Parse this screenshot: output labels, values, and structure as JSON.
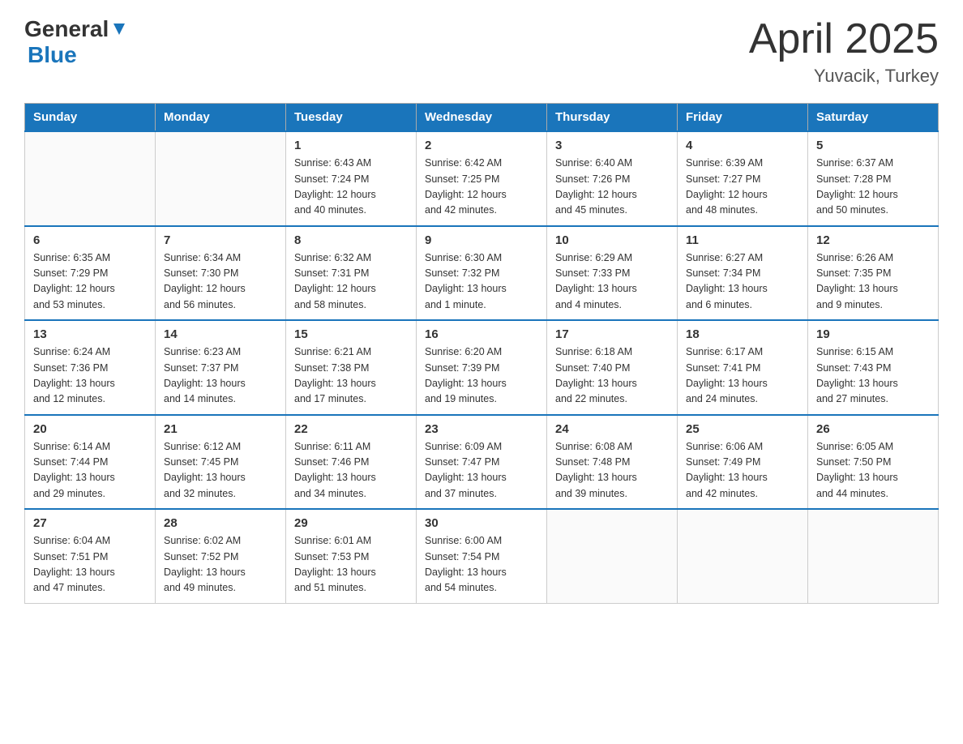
{
  "header": {
    "logo_general": "General",
    "logo_blue": "Blue",
    "month_title": "April 2025",
    "location": "Yuvacik, Turkey"
  },
  "days_of_week": [
    "Sunday",
    "Monday",
    "Tuesday",
    "Wednesday",
    "Thursday",
    "Friday",
    "Saturday"
  ],
  "weeks": [
    [
      {
        "day": "",
        "info": ""
      },
      {
        "day": "",
        "info": ""
      },
      {
        "day": "1",
        "info": "Sunrise: 6:43 AM\nSunset: 7:24 PM\nDaylight: 12 hours\nand 40 minutes."
      },
      {
        "day": "2",
        "info": "Sunrise: 6:42 AM\nSunset: 7:25 PM\nDaylight: 12 hours\nand 42 minutes."
      },
      {
        "day": "3",
        "info": "Sunrise: 6:40 AM\nSunset: 7:26 PM\nDaylight: 12 hours\nand 45 minutes."
      },
      {
        "day": "4",
        "info": "Sunrise: 6:39 AM\nSunset: 7:27 PM\nDaylight: 12 hours\nand 48 minutes."
      },
      {
        "day": "5",
        "info": "Sunrise: 6:37 AM\nSunset: 7:28 PM\nDaylight: 12 hours\nand 50 minutes."
      }
    ],
    [
      {
        "day": "6",
        "info": "Sunrise: 6:35 AM\nSunset: 7:29 PM\nDaylight: 12 hours\nand 53 minutes."
      },
      {
        "day": "7",
        "info": "Sunrise: 6:34 AM\nSunset: 7:30 PM\nDaylight: 12 hours\nand 56 minutes."
      },
      {
        "day": "8",
        "info": "Sunrise: 6:32 AM\nSunset: 7:31 PM\nDaylight: 12 hours\nand 58 minutes."
      },
      {
        "day": "9",
        "info": "Sunrise: 6:30 AM\nSunset: 7:32 PM\nDaylight: 13 hours\nand 1 minute."
      },
      {
        "day": "10",
        "info": "Sunrise: 6:29 AM\nSunset: 7:33 PM\nDaylight: 13 hours\nand 4 minutes."
      },
      {
        "day": "11",
        "info": "Sunrise: 6:27 AM\nSunset: 7:34 PM\nDaylight: 13 hours\nand 6 minutes."
      },
      {
        "day": "12",
        "info": "Sunrise: 6:26 AM\nSunset: 7:35 PM\nDaylight: 13 hours\nand 9 minutes."
      }
    ],
    [
      {
        "day": "13",
        "info": "Sunrise: 6:24 AM\nSunset: 7:36 PM\nDaylight: 13 hours\nand 12 minutes."
      },
      {
        "day": "14",
        "info": "Sunrise: 6:23 AM\nSunset: 7:37 PM\nDaylight: 13 hours\nand 14 minutes."
      },
      {
        "day": "15",
        "info": "Sunrise: 6:21 AM\nSunset: 7:38 PM\nDaylight: 13 hours\nand 17 minutes."
      },
      {
        "day": "16",
        "info": "Sunrise: 6:20 AM\nSunset: 7:39 PM\nDaylight: 13 hours\nand 19 minutes."
      },
      {
        "day": "17",
        "info": "Sunrise: 6:18 AM\nSunset: 7:40 PM\nDaylight: 13 hours\nand 22 minutes."
      },
      {
        "day": "18",
        "info": "Sunrise: 6:17 AM\nSunset: 7:41 PM\nDaylight: 13 hours\nand 24 minutes."
      },
      {
        "day": "19",
        "info": "Sunrise: 6:15 AM\nSunset: 7:43 PM\nDaylight: 13 hours\nand 27 minutes."
      }
    ],
    [
      {
        "day": "20",
        "info": "Sunrise: 6:14 AM\nSunset: 7:44 PM\nDaylight: 13 hours\nand 29 minutes."
      },
      {
        "day": "21",
        "info": "Sunrise: 6:12 AM\nSunset: 7:45 PM\nDaylight: 13 hours\nand 32 minutes."
      },
      {
        "day": "22",
        "info": "Sunrise: 6:11 AM\nSunset: 7:46 PM\nDaylight: 13 hours\nand 34 minutes."
      },
      {
        "day": "23",
        "info": "Sunrise: 6:09 AM\nSunset: 7:47 PM\nDaylight: 13 hours\nand 37 minutes."
      },
      {
        "day": "24",
        "info": "Sunrise: 6:08 AM\nSunset: 7:48 PM\nDaylight: 13 hours\nand 39 minutes."
      },
      {
        "day": "25",
        "info": "Sunrise: 6:06 AM\nSunset: 7:49 PM\nDaylight: 13 hours\nand 42 minutes."
      },
      {
        "day": "26",
        "info": "Sunrise: 6:05 AM\nSunset: 7:50 PM\nDaylight: 13 hours\nand 44 minutes."
      }
    ],
    [
      {
        "day": "27",
        "info": "Sunrise: 6:04 AM\nSunset: 7:51 PM\nDaylight: 13 hours\nand 47 minutes."
      },
      {
        "day": "28",
        "info": "Sunrise: 6:02 AM\nSunset: 7:52 PM\nDaylight: 13 hours\nand 49 minutes."
      },
      {
        "day": "29",
        "info": "Sunrise: 6:01 AM\nSunset: 7:53 PM\nDaylight: 13 hours\nand 51 minutes."
      },
      {
        "day": "30",
        "info": "Sunrise: 6:00 AM\nSunset: 7:54 PM\nDaylight: 13 hours\nand 54 minutes."
      },
      {
        "day": "",
        "info": ""
      },
      {
        "day": "",
        "info": ""
      },
      {
        "day": "",
        "info": ""
      }
    ]
  ]
}
